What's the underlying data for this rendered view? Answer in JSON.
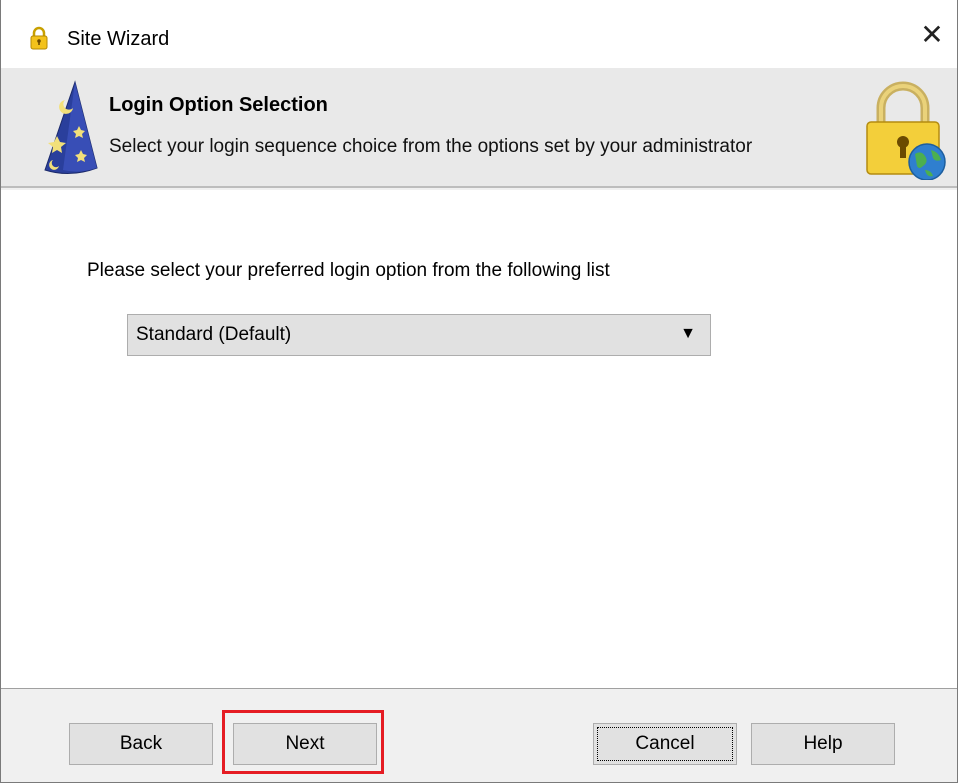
{
  "window": {
    "title": "Site Wizard",
    "close_label": "✕"
  },
  "header": {
    "title": "Login Option Selection",
    "subtitle": "Select your login sequence choice from the options set by your administrator"
  },
  "content": {
    "instructions": "Please select your preferred  login option from the following list",
    "login_option": {
      "selected": "Standard  (Default)"
    }
  },
  "footer": {
    "back_label": "Back",
    "next_label": "Next",
    "cancel_label": "Cancel",
    "help_label": "Help"
  },
  "colors": {
    "highlight": "#e51c23",
    "header_bg": "#e9e9e9",
    "button_bg": "#e1e1e1"
  },
  "icons": {
    "title": "padlock-icon",
    "header_left": "wizard-hat-icon",
    "header_right": "lock-globe-icon",
    "dropdown": "dropdown-arrow-icon",
    "close": "close-icon"
  }
}
